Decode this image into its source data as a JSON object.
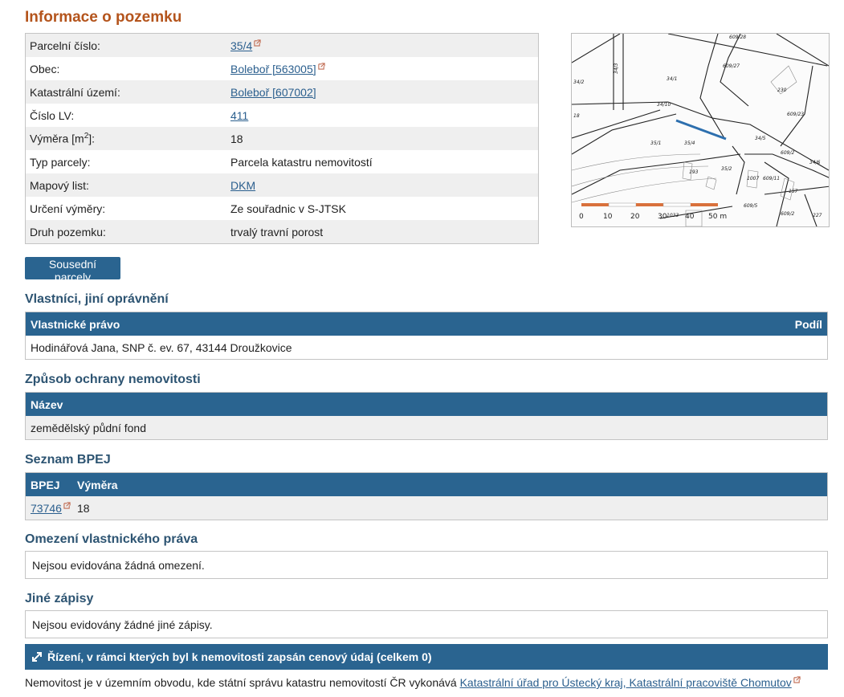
{
  "page_title": "Informace o pozemku",
  "parcel_info": {
    "rows": [
      {
        "label": "Parcelní číslo:",
        "value": "35/4"
      },
      {
        "label": "Obec:",
        "value": "Boleboř [563005]"
      },
      {
        "label": "Katastrální území:",
        "value": "Boleboř [607002]"
      },
      {
        "label": "Číslo LV:",
        "value": "411"
      },
      {
        "label": "Výměra [m",
        "label_sup": "2",
        "label_tail": "]:",
        "value": "18"
      },
      {
        "label": "Typ parcely:",
        "value": "Parcela katastru nemovitostí"
      },
      {
        "label": "Mapový list:",
        "value": "DKM"
      },
      {
        "label": "Určení výměry:",
        "value": "Ze souřadnic v S-JTSK"
      },
      {
        "label": "Druh pozemku:",
        "value": "trvalý travní porost"
      }
    ]
  },
  "map": {
    "parcel_labels": [
      "609/28",
      "34/2",
      "34/3",
      "34/1",
      "609/27",
      "230",
      "609/23",
      "18",
      "34/10",
      "35/1",
      "35/4",
      "34/5",
      "609/2",
      "34/6",
      "193",
      "35/2",
      "1007",
      "609/11",
      "157",
      "609/5",
      "609/2",
      "1033",
      "227"
    ],
    "scale_labels": [
      "0",
      "10",
      "20",
      "30",
      "40",
      "50 m"
    ]
  },
  "neighbors_button": "Sousední parcely",
  "owners": {
    "title": "Vlastníci, jiní oprávnění",
    "col_right": "Vlastnické právo",
    "col_share": "Podíl",
    "row": "Hodinářová Jana, SNP č. ev. 67, 43144 Droužkovice"
  },
  "protection": {
    "title": "Způsob ochrany nemovitosti",
    "col_name": "Název",
    "row": "zemědělský půdní fond"
  },
  "bpej": {
    "title": "Seznam BPEJ",
    "col_bpej": "BPEJ",
    "col_area": "Výměra",
    "code": "73746",
    "area": "18"
  },
  "restrictions": {
    "title": "Omezení vlastnického práva",
    "text": "Nejsou evidována žádná omezení."
  },
  "other_records": {
    "title": "Jiné zápisy",
    "text": "Nejsou evidovány žádné jiné zápisy."
  },
  "proceedings_bar": "Řízení, v rámci kterých byl k nemovitosti zapsán cenový údaj (celkem 0)",
  "footer": {
    "text": "Nemovitost je v územním obvodu, kde státní správu katastru nemovitostí ČR vykonává ",
    "link": "Katastrální úřad pro Ústecký kraj, Katastrální pracoviště Chomutov"
  },
  "colors": {
    "title": "#b4541c",
    "header": "#2a6490",
    "section_title": "#2d5472",
    "link": "#2b5f8e"
  }
}
